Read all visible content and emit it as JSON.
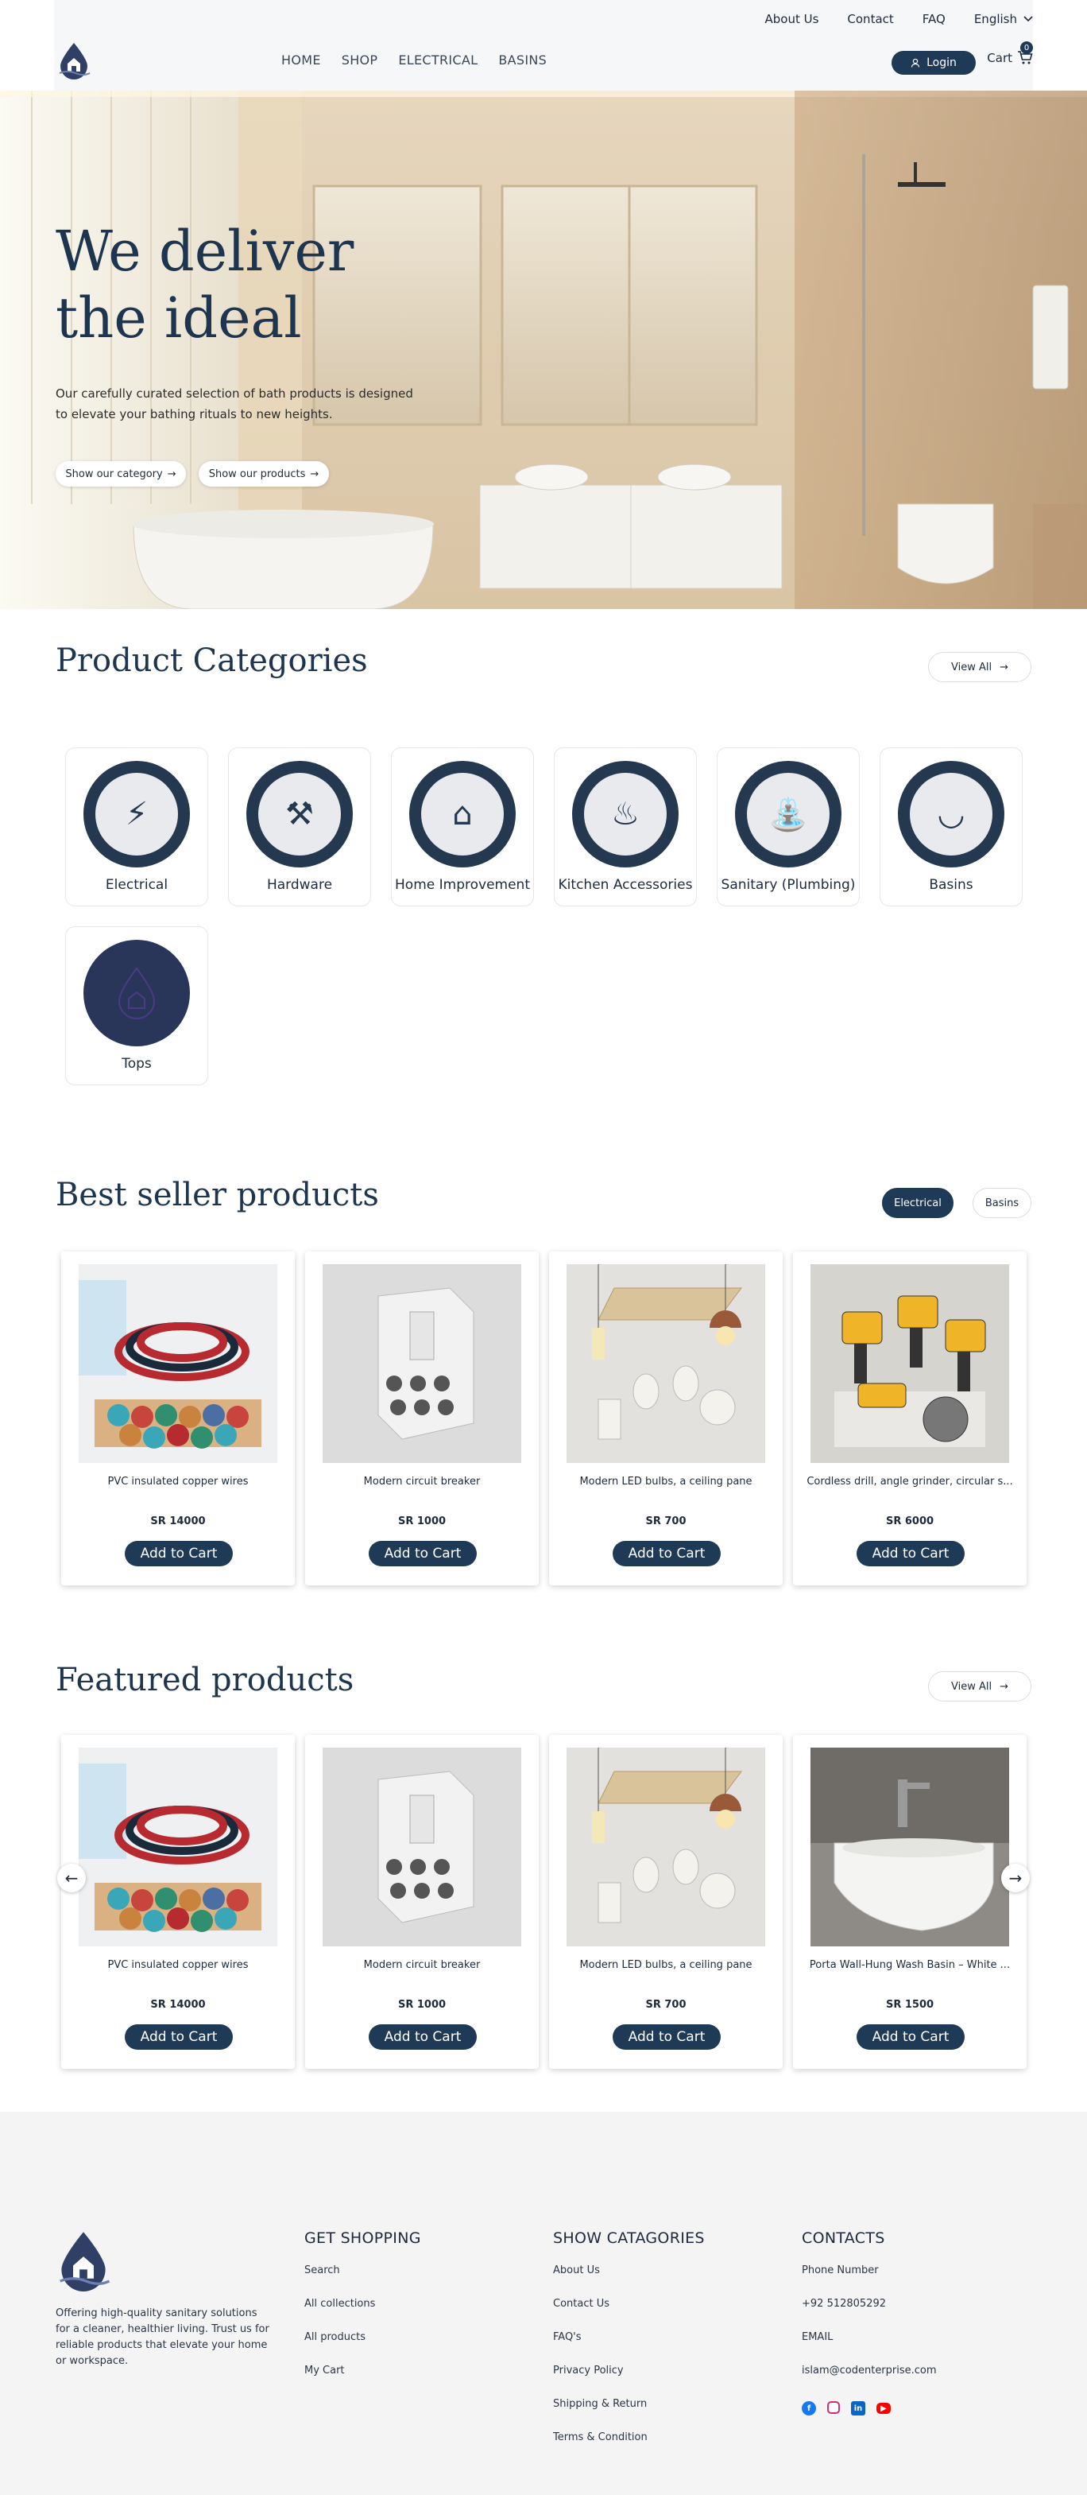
{
  "header": {
    "top_links": [
      "About Us",
      "Contact",
      "FAQ"
    ],
    "language": "English",
    "nav": [
      "HOME",
      "SHOP",
      "ELECTRICAL",
      "BASINS"
    ],
    "login_label": "Login",
    "cart_label": "Cart",
    "cart_count": "0"
  },
  "hero": {
    "title_line1": "We deliver",
    "title_line2": "the ideal",
    "subtitle": "Our carefully curated selection of bath products is designed to elevate your bathing rituals to new heights.",
    "btn_category": "Show our category",
    "btn_products": "Show our products"
  },
  "categories": {
    "title": "Product Categories",
    "view_all": "View All",
    "items": [
      "Electrical",
      "Hardware",
      "Home Improvement",
      "Kitchen Accessories",
      "Sanitary (Plumbing)",
      "Basins",
      "Tops"
    ]
  },
  "best_seller": {
    "title": "Best seller products",
    "tabs": [
      "Electrical",
      "Basins"
    ],
    "products": [
      {
        "name": "PVC insulated copper wires",
        "price": "SR 14000"
      },
      {
        "name": "Modern circuit breaker",
        "price": "SR 1000"
      },
      {
        "name": "Modern LED bulbs, a ceiling pane",
        "price": "SR 700"
      },
      {
        "name": "Cordless drill, angle grinder, circular s...",
        "price": "SR 6000"
      }
    ],
    "add_to_cart": "Add to Cart"
  },
  "featured": {
    "title": "Featured products",
    "view_all": "View All",
    "products": [
      {
        "name": "PVC insulated copper wires",
        "price": "SR 14000"
      },
      {
        "name": "Modern circuit breaker",
        "price": "SR 1000"
      },
      {
        "name": "Modern LED bulbs, a ceiling pane",
        "price": "SR 700"
      },
      {
        "name": "Porta Wall-Hung Wash Basin – White ...",
        "price": "SR 1500"
      }
    ],
    "add_to_cart": "Add to Cart"
  },
  "footer": {
    "description": "Offering high-quality sanitary solutions for a cleaner, healthier living. Trust us for reliable products that elevate your home or workspace.",
    "shopping_title": "GET SHOPPING",
    "shopping_links": [
      "Search",
      "All collections",
      "All products",
      "My Cart"
    ],
    "categories_title": "SHOW CATAGORIES",
    "categories_links": [
      "About Us",
      "Contact Us",
      "FAQ's",
      "Privacy Policy",
      "Shipping & Return",
      "Terms & Condition"
    ],
    "contacts_title": "CONTACTS",
    "phone_label": "Phone Number",
    "phone": "+92 512805292",
    "email_label": "EMAIL",
    "email": "islam@codenterprise.com"
  },
  "colors": {
    "brand": "#1f3a57",
    "heading": "#1e3550",
    "footer_bg": "#f4f4f4"
  }
}
